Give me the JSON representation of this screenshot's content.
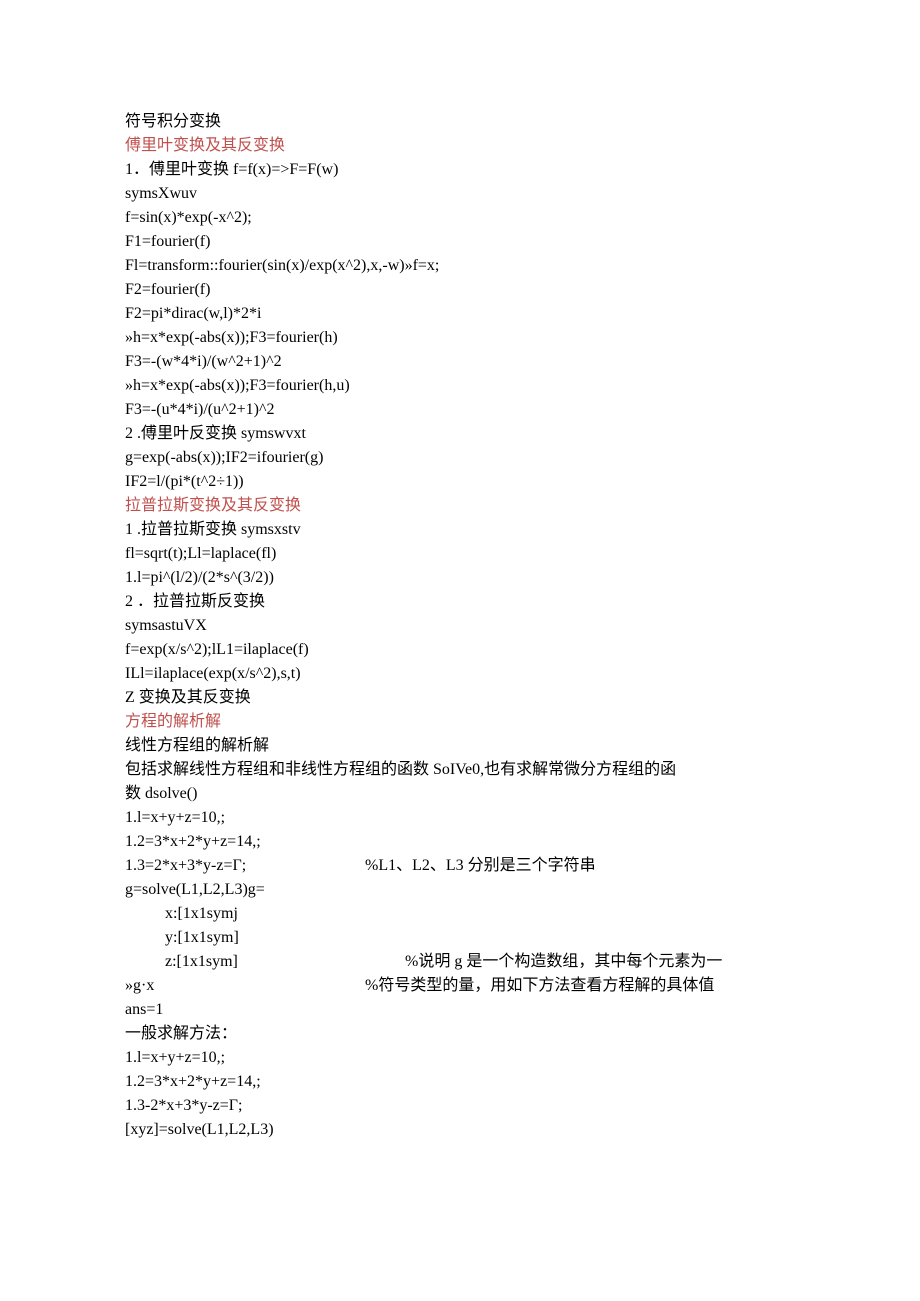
{
  "lines": [
    {
      "text": "符号积分变换"
    },
    {
      "text": "傅里叶变换及其反变换",
      "class": "red"
    },
    {
      "text": "1．傅里叶变换 f=f(x)=>F=F(w)"
    },
    {
      "text": "symsXwuv"
    },
    {
      "text": "f=sin(x)*exp(-x^2);"
    },
    {
      "text": "F1=fourier(f)"
    },
    {
      "text": "Fl=transform::fourier(sin(x)/exp(x^2),x,-w)»f=x;"
    },
    {
      "text": "F2=fourier(f)"
    },
    {
      "text": "F2=pi*dirac(w,l)*2*i"
    },
    {
      "text": "»h=x*exp(-abs(x));F3=fourier(h)"
    },
    {
      "text": "F3=-(w*4*i)/(w^2+1)^2"
    },
    {
      "text": "»h=x*exp(-abs(x));F3=fourier(h,u)"
    },
    {
      "text": "F3=-(u*4*i)/(u^2+1)^2"
    },
    {
      "text": "2 .傅里叶反变换 symswvxt"
    },
    {
      "text": "g=exp(-abs(x));IF2=ifourier(g)"
    },
    {
      "text": "IF2=l/(pi*(t^2÷1))"
    },
    {
      "text": "拉普拉斯变换及其反变换",
      "class": "red"
    },
    {
      "text": "1 .拉普拉斯变换 symsxstv"
    },
    {
      "text": "fl=sqrt(t);Ll=laplace(fl)"
    },
    {
      "text": "1.l=pi^(l/2)/(2*s^(3/2))"
    },
    {
      "text": "2 ．拉普拉斯反变换"
    },
    {
      "text": "symsastuVX"
    },
    {
      "text": "f=exp(x/s^2);lL1=ilaplace(f)"
    },
    {
      "text": "ILl=ilaplace(exp(x/s^2),s,t)"
    },
    {
      "text": "Z 变换及其反变换"
    },
    {
      "text": "方程的解析解",
      "class": "red"
    },
    {
      "text": "线性方程组的解析解"
    },
    {
      "text": "包括求解线性方程组和非线性方程组的函数 SoIVe0,也有求解常微分方程组的函"
    },
    {
      "text": "数 dsolve()"
    },
    {
      "text": "1.l=x+y+z=10,;"
    },
    {
      "text": "1.2=3*x+2*y+z=14,;"
    }
  ],
  "row1_left": "1.3=2*x+3*y-z=Γ;",
  "row1_right": "%L1、L2、L3 分别是三个字符串",
  "line_g": "g=solve(L1,L2,L3)g=",
  "line_x": "x:[1x1symj",
  "line_y": "y:[1x1sym]",
  "row2_left": "z:[1x1sym]",
  "row2_right": "%说明 g 是一个构造数组，其中每个元素为一",
  "row3_left": "»g·x",
  "row3_right": "%符号类型的量，用如下方法查看方程解的具体值",
  "footer": [
    {
      "text": "ans=1"
    },
    {
      "text": "一般求解方法："
    },
    {
      "text": "1.l=x+y+z=10,;"
    },
    {
      "text": "1.2=3*x+2*y+z=14,;"
    },
    {
      "text": "1.3-2*x+3*y-z=Γ;"
    },
    {
      "text": "[xyz]=solve(L1,L2,L3)"
    }
  ]
}
